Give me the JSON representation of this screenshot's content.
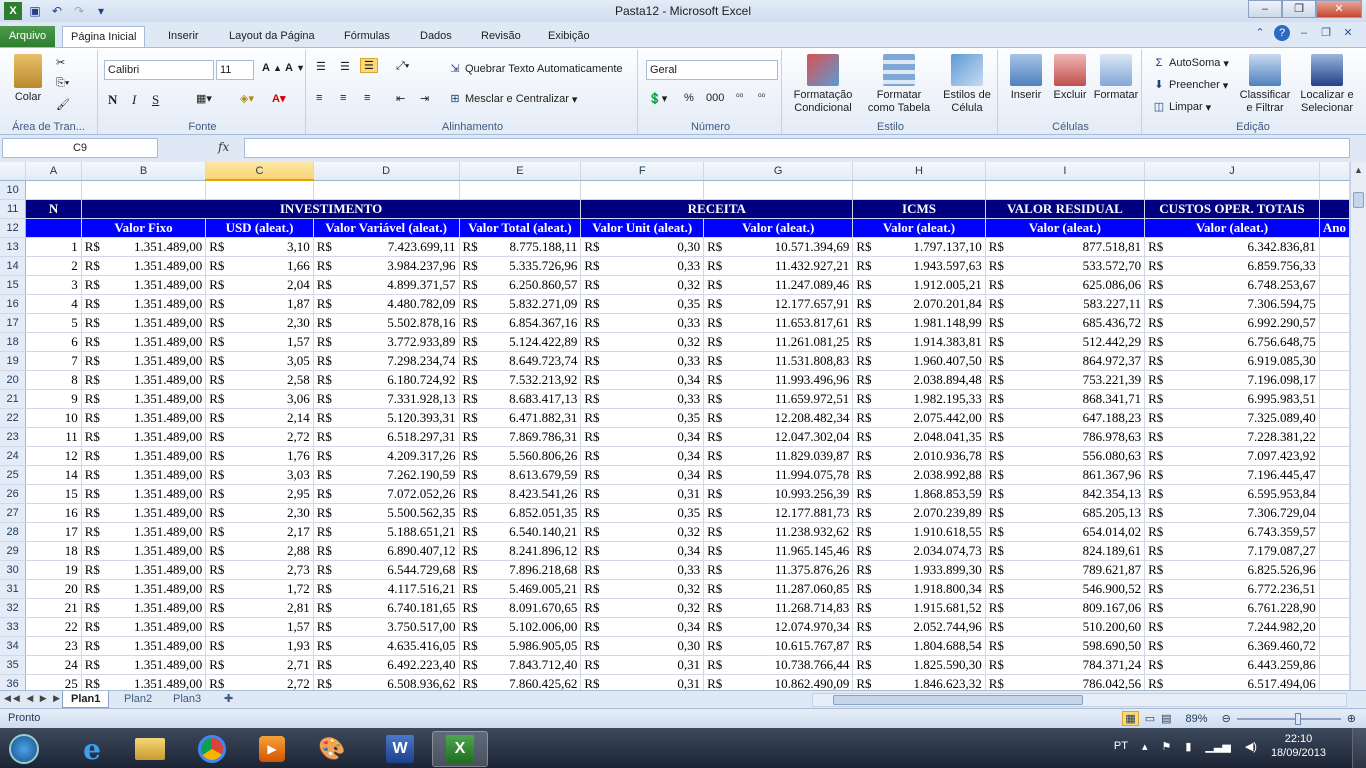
{
  "window": {
    "title": "Pasta12  -  Microsoft Excel",
    "min": "–",
    "max": "❐",
    "close": "✕"
  },
  "tabs": [
    "Arquivo",
    "Página Inicial",
    "Inserir",
    "Layout da Página",
    "Fórmulas",
    "Dados",
    "Revisão",
    "Exibição"
  ],
  "ribbon": {
    "clipboard": {
      "label": "Área de Tran...",
      "paste": "Colar"
    },
    "font": {
      "label": "Fonte",
      "name": "Calibri",
      "size": "11",
      "bold": "N",
      "italic": "I",
      "underline": "S"
    },
    "alignment": {
      "label": "Alinhamento",
      "wrap": "Quebrar Texto Automaticamente",
      "merge": "Mesclar e Centralizar"
    },
    "number": {
      "label": "Número",
      "format": "Geral",
      "pct": "%",
      "thousands": "000"
    },
    "styles": {
      "label": "Estilo",
      "cond1": "Formatação",
      "cond2": "Condicional",
      "table1": "Formatar",
      "table2": "como Tabela",
      "cell1": "Estilos de",
      "cell2": "Célula"
    },
    "cells": {
      "label": "Células",
      "insert": "Inserir",
      "delete": "Excluir",
      "format": "Formatar"
    },
    "editing": {
      "label": "Edição",
      "autosum": "AutoSoma",
      "fill": "Preencher",
      "clear": "Limpar",
      "sort1": "Classificar",
      "sort2": "e Filtrar",
      "find1": "Localizar e",
      "find2": "Selecionar"
    }
  },
  "namebox": "C9",
  "fx": "fx",
  "columns": [
    "A",
    "B",
    "C",
    "D",
    "E",
    "F",
    "G",
    "H",
    "I",
    "J"
  ],
  "headers": {
    "n": "N",
    "investimento": "INVESTIMENTO",
    "receita": "RECEITA",
    "icms": "ICMS",
    "residual": "VALOR RESIDUAL",
    "custos": "CUSTOS OPER. TOTAIS",
    "sub": [
      "Valor Fixo",
      "USD (aleat.)",
      "Valor Variável (aleat.)",
      "Valor Total (aleat.)",
      "Valor Unit (aleat.)",
      "Valor (aleat.)",
      "Valor (aleat.)",
      "Valor (aleat.)",
      "Valor (aleat.)"
    ],
    "extra": "Ano"
  },
  "currency": "R$",
  "rows": [
    {
      "r": "13",
      "n": "1",
      "b": "1.351.489,00",
      "c": "3,10",
      "d": "7.423.699,11",
      "e": "8.775.188,11",
      "f": "0,30",
      "g": "10.571.394,69",
      "h": "1.797.137,10",
      "i": "877.518,81",
      "j": "6.342.836,81"
    },
    {
      "r": "14",
      "n": "2",
      "b": "1.351.489,00",
      "c": "1,66",
      "d": "3.984.237,96",
      "e": "5.335.726,96",
      "f": "0,33",
      "g": "11.432.927,21",
      "h": "1.943.597,63",
      "i": "533.572,70",
      "j": "6.859.756,33"
    },
    {
      "r": "15",
      "n": "3",
      "b": "1.351.489,00",
      "c": "2,04",
      "d": "4.899.371,57",
      "e": "6.250.860,57",
      "f": "0,32",
      "g": "11.247.089,46",
      "h": "1.912.005,21",
      "i": "625.086,06",
      "j": "6.748.253,67"
    },
    {
      "r": "16",
      "n": "4",
      "b": "1.351.489,00",
      "c": "1,87",
      "d": "4.480.782,09",
      "e": "5.832.271,09",
      "f": "0,35",
      "g": "12.177.657,91",
      "h": "2.070.201,84",
      "i": "583.227,11",
      "j": "7.306.594,75"
    },
    {
      "r": "17",
      "n": "5",
      "b": "1.351.489,00",
      "c": "2,30",
      "d": "5.502.878,16",
      "e": "6.854.367,16",
      "f": "0,33",
      "g": "11.653.817,61",
      "h": "1.981.148,99",
      "i": "685.436,72",
      "j": "6.992.290,57"
    },
    {
      "r": "18",
      "n": "6",
      "b": "1.351.489,00",
      "c": "1,57",
      "d": "3.772.933,89",
      "e": "5.124.422,89",
      "f": "0,32",
      "g": "11.261.081,25",
      "h": "1.914.383,81",
      "i": "512.442,29",
      "j": "6.756.648,75"
    },
    {
      "r": "19",
      "n": "7",
      "b": "1.351.489,00",
      "c": "3,05",
      "d": "7.298.234,74",
      "e": "8.649.723,74",
      "f": "0,33",
      "g": "11.531.808,83",
      "h": "1.960.407,50",
      "i": "864.972,37",
      "j": "6.919.085,30"
    },
    {
      "r": "20",
      "n": "8",
      "b": "1.351.489,00",
      "c": "2,58",
      "d": "6.180.724,92",
      "e": "7.532.213,92",
      "f": "0,34",
      "g": "11.993.496,96",
      "h": "2.038.894,48",
      "i": "753.221,39",
      "j": "7.196.098,17"
    },
    {
      "r": "21",
      "n": "9",
      "b": "1.351.489,00",
      "c": "3,06",
      "d": "7.331.928,13",
      "e": "8.683.417,13",
      "f": "0,33",
      "g": "11.659.972,51",
      "h": "1.982.195,33",
      "i": "868.341,71",
      "j": "6.995.983,51"
    },
    {
      "r": "22",
      "n": "10",
      "b": "1.351.489,00",
      "c": "2,14",
      "d": "5.120.393,31",
      "e": "6.471.882,31",
      "f": "0,35",
      "g": "12.208.482,34",
      "h": "2.075.442,00",
      "i": "647.188,23",
      "j": "7.325.089,40"
    },
    {
      "r": "23",
      "n": "11",
      "b": "1.351.489,00",
      "c": "2,72",
      "d": "6.518.297,31",
      "e": "7.869.786,31",
      "f": "0,34",
      "g": "12.047.302,04",
      "h": "2.048.041,35",
      "i": "786.978,63",
      "j": "7.228.381,22"
    },
    {
      "r": "24",
      "n": "12",
      "b": "1.351.489,00",
      "c": "1,76",
      "d": "4.209.317,26",
      "e": "5.560.806,26",
      "f": "0,34",
      "g": "11.829.039,87",
      "h": "2.010.936,78",
      "i": "556.080,63",
      "j": "7.097.423,92"
    },
    {
      "r": "25",
      "n": "14",
      "b": "1.351.489,00",
      "c": "3,03",
      "d": "7.262.190,59",
      "e": "8.613.679,59",
      "f": "0,34",
      "g": "11.994.075,78",
      "h": "2.038.992,88",
      "i": "861.367,96",
      "j": "7.196.445,47"
    },
    {
      "r": "26",
      "n": "15",
      "b": "1.351.489,00",
      "c": "2,95",
      "d": "7.072.052,26",
      "e": "8.423.541,26",
      "f": "0,31",
      "g": "10.993.256,39",
      "h": "1.868.853,59",
      "i": "842.354,13",
      "j": "6.595.953,84"
    },
    {
      "r": "27",
      "n": "16",
      "b": "1.351.489,00",
      "c": "2,30",
      "d": "5.500.562,35",
      "e": "6.852.051,35",
      "f": "0,35",
      "g": "12.177.881,73",
      "h": "2.070.239,89",
      "i": "685.205,13",
      "j": "7.306.729,04"
    },
    {
      "r": "28",
      "n": "17",
      "b": "1.351.489,00",
      "c": "2,17",
      "d": "5.188.651,21",
      "e": "6.540.140,21",
      "f": "0,32",
      "g": "11.238.932,62",
      "h": "1.910.618,55",
      "i": "654.014,02",
      "j": "6.743.359,57"
    },
    {
      "r": "29",
      "n": "18",
      "b": "1.351.489,00",
      "c": "2,88",
      "d": "6.890.407,12",
      "e": "8.241.896,12",
      "f": "0,34",
      "g": "11.965.145,46",
      "h": "2.034.074,73",
      "i": "824.189,61",
      "j": "7.179.087,27"
    },
    {
      "r": "30",
      "n": "19",
      "b": "1.351.489,00",
      "c": "2,73",
      "d": "6.544.729,68",
      "e": "7.896.218,68",
      "f": "0,33",
      "g": "11.375.876,26",
      "h": "1.933.899,30",
      "i": "789.621,87",
      "j": "6.825.526,96"
    },
    {
      "r": "31",
      "n": "20",
      "b": "1.351.489,00",
      "c": "1,72",
      "d": "4.117.516,21",
      "e": "5.469.005,21",
      "f": "0,32",
      "g": "11.287.060,85",
      "h": "1.918.800,34",
      "i": "546.900,52",
      "j": "6.772.236,51"
    },
    {
      "r": "32",
      "n": "21",
      "b": "1.351.489,00",
      "c": "2,81",
      "d": "6.740.181,65",
      "e": "8.091.670,65",
      "f": "0,32",
      "g": "11.268.714,83",
      "h": "1.915.681,52",
      "i": "809.167,06",
      "j": "6.761.228,90"
    },
    {
      "r": "33",
      "n": "22",
      "b": "1.351.489,00",
      "c": "1,57",
      "d": "3.750.517,00",
      "e": "5.102.006,00",
      "f": "0,34",
      "g": "12.074.970,34",
      "h": "2.052.744,96",
      "i": "510.200,60",
      "j": "7.244.982,20"
    },
    {
      "r": "34",
      "n": "23",
      "b": "1.351.489,00",
      "c": "1,93",
      "d": "4.635.416,05",
      "e": "5.986.905,05",
      "f": "0,30",
      "g": "10.615.767,87",
      "h": "1.804.688,54",
      "i": "598.690,50",
      "j": "6.369.460,72"
    },
    {
      "r": "35",
      "n": "24",
      "b": "1.351.489,00",
      "c": "2,71",
      "d": "6.492.223,40",
      "e": "7.843.712,40",
      "f": "0,31",
      "g": "10.738.766,44",
      "h": "1.825.590,30",
      "i": "784.371,24",
      "j": "6.443.259,86"
    },
    {
      "r": "36",
      "n": "25",
      "b": "1.351.489,00",
      "c": "2,72",
      "d": "6.508.936,62",
      "e": "7.860.425,62",
      "f": "0,31",
      "g": "10.862.490,09",
      "h": "1.846.623,32",
      "i": "786.042,56",
      "j": "6.517.494,06"
    }
  ],
  "sheets": [
    "Plan1",
    "Plan2",
    "Plan3"
  ],
  "status": "Pronto",
  "zoom": "89%",
  "tray": {
    "lang": "PT",
    "time": "22:10",
    "date": "18/09/2013"
  },
  "colors": {
    "header_dark": "#000080",
    "header_blue": "#0000ff",
    "excel_green": "#2f7d2f"
  }
}
